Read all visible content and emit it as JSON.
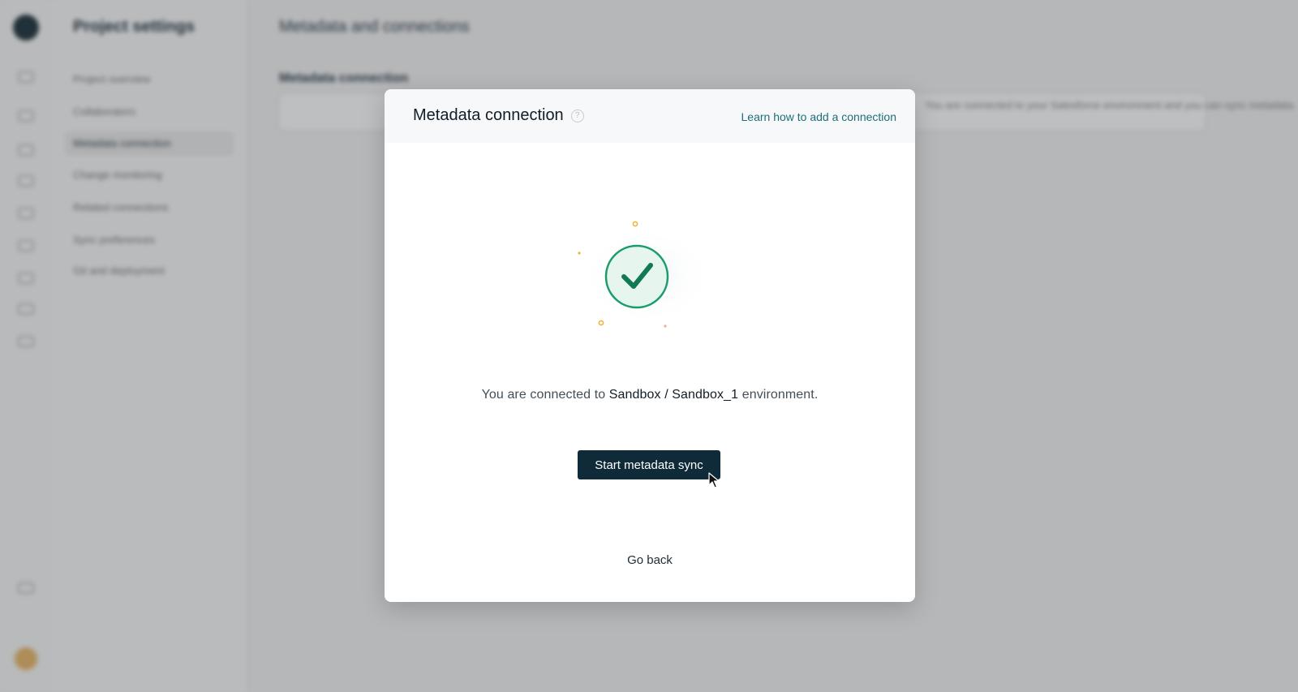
{
  "background": {
    "settings_title": "Project settings",
    "nav_items": [
      "Project overview",
      "Collaborators",
      "Metadata connection",
      "Change monitoring",
      "Related connections",
      "Sync preferences",
      "Git and deployment"
    ],
    "page_title": "Metadata and connections",
    "section_title": "Metadata connection",
    "card_text": "You are connected to your Salesforce environment and you can sync metadata."
  },
  "modal": {
    "title": "Metadata connection",
    "help_icon": "help-circle-icon",
    "learn_link": "Learn how to add a connection",
    "message_prefix": "You are connected to",
    "environment": "Sandbox / Sandbox_1",
    "message_suffix": "environment.",
    "primary_button": "Start metadata sync",
    "back_link": "Go back"
  },
  "colors": {
    "primary": "#0f2a38",
    "success": "#1a9c6b",
    "link": "#1d6e7a",
    "confetti": "#f0b43c"
  }
}
